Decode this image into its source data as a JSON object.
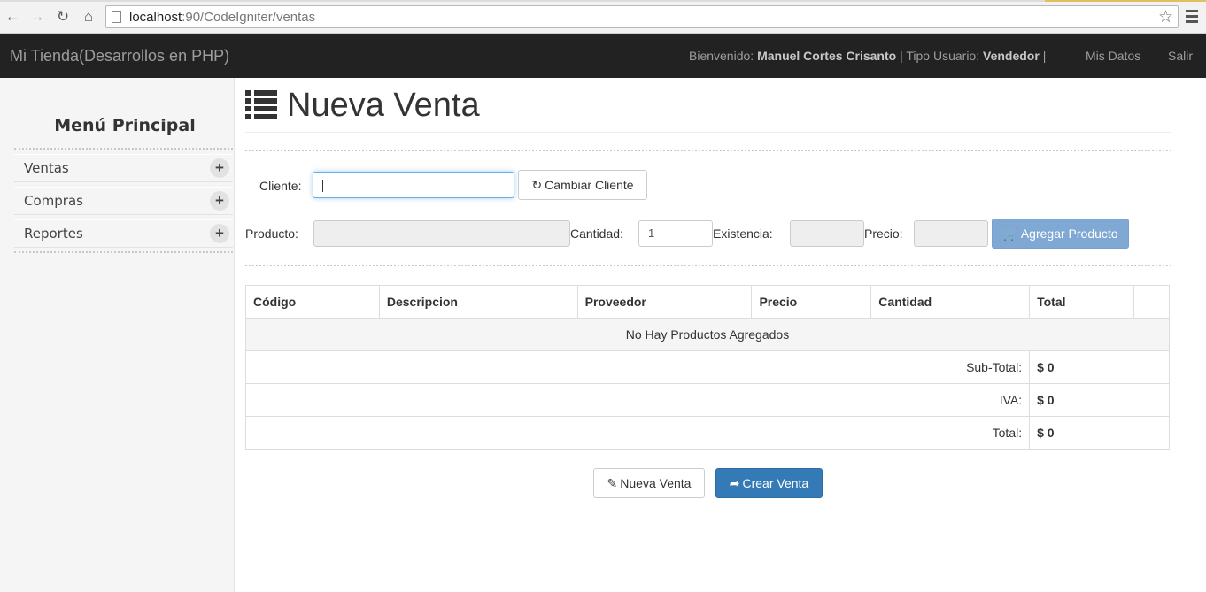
{
  "browser": {
    "url_host": "localhost",
    "url_path": ":90/CodeIgniter/ventas"
  },
  "navbar": {
    "brand": "Mi Tienda(Desarrollos en PHP)",
    "welcome_label": "Bienvenido:",
    "user_name": "Manuel Cortes Crisanto",
    "user_type_label": "| Tipo Usuario:",
    "user_type": "Vendedor",
    "sep": "|",
    "mis_datos": "Mis Datos",
    "salir": "Salir"
  },
  "sidebar": {
    "title": "Menú Principal",
    "items": [
      {
        "label": "Ventas"
      },
      {
        "label": "Compras"
      },
      {
        "label": "Reportes"
      }
    ]
  },
  "main": {
    "title": "Nueva Venta",
    "cliente_label": "Cliente:",
    "cliente_value": "",
    "cambiar_cliente": "Cambiar Cliente",
    "producto_label": "Producto:",
    "cantidad_label": "Cantidad:",
    "cantidad_value": "1",
    "existencia_label": "Existencia:",
    "precio_label": "Precio:",
    "agregar_producto": "Agregar Producto",
    "table": {
      "headers": [
        "Código",
        "Descripcion",
        "Proveedor",
        "Precio",
        "Cantidad",
        "Total",
        ""
      ],
      "empty_message": "No Hay Productos Agregados",
      "subtotal_label": "Sub-Total:",
      "subtotal_value": "$ 0",
      "iva_label": "IVA:",
      "iva_value": "$ 0",
      "total_label": "Total:",
      "total_value": "$ 0"
    },
    "nueva_venta": "Nueva Venta",
    "crear_venta": "Crear Venta"
  }
}
